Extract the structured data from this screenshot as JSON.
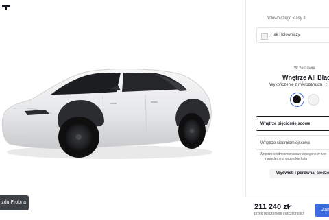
{
  "header": {
    "logo_icon": "tesla-logo-icon"
  },
  "viewer": {
    "demo_button": "zdu Probna"
  },
  "config": {
    "tow_note": "holowniczego klasy II",
    "tow_option": "Hak Holowniczy",
    "standard_label": "W zestawie",
    "interior_title": "Wnętrze All Black",
    "interior_subtitle": "Wykończenie z mikrozamszu i t",
    "swatches": [
      {
        "name": "black",
        "color": "#111111",
        "selected": true
      },
      {
        "name": "white",
        "color": "#f2f2f2",
        "selected": false
      }
    ],
    "seat_five": "Wnętrze pięciomiejscowe",
    "seat_seven": "Wnętrze siedmiomiejscowe",
    "seat_seven_note_line1": "Wnętrze siedmiomiejscowe dostępne w wer",
    "seat_seven_note_line2": "napędem na wszystkie koła",
    "compare_button": "Wyświetl i porównaj siedze"
  },
  "footer": {
    "price": "211 240 zł",
    "price_note": "przed odliczeniem oszczędności",
    "order_button": "Zam",
    "accent": "#3e6ae1"
  }
}
